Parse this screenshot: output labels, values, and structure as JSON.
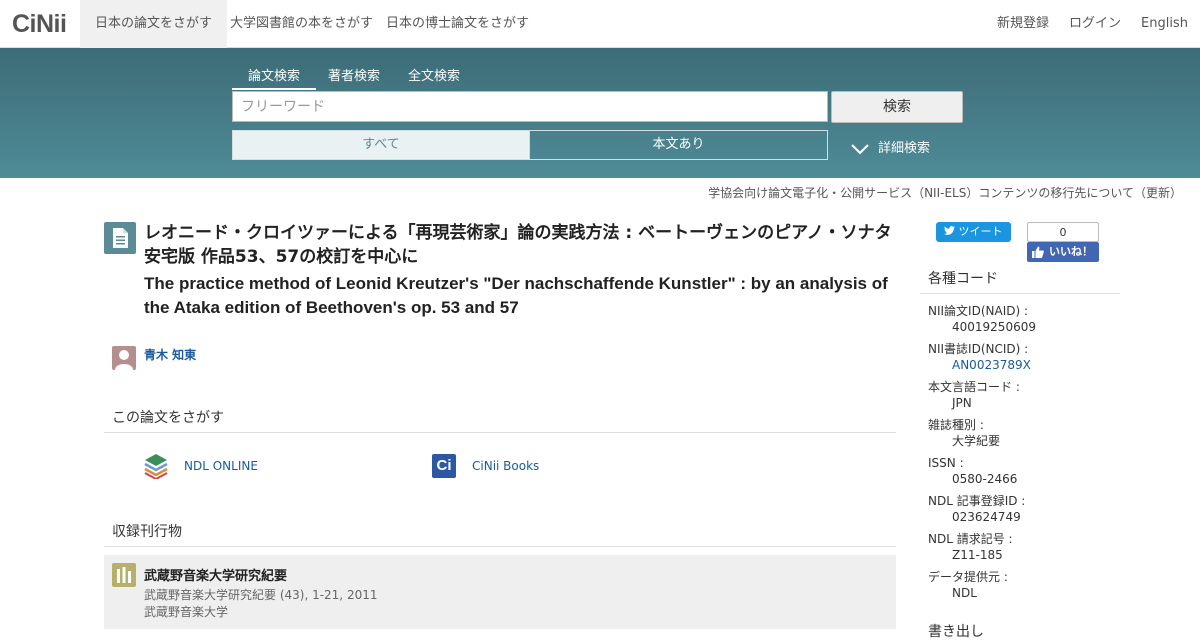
{
  "logo": "CiNii",
  "nav": {
    "tabs": [
      "日本の論文をさがす",
      "大学図書館の本をさがす",
      "日本の博士論文をさがす"
    ],
    "right": [
      "新規登録",
      "ログイン",
      "English"
    ]
  },
  "search": {
    "tabs": [
      "論文検索",
      "著者検索",
      "全文検索"
    ],
    "placeholder": "フリーワード",
    "button": "検索",
    "filter_all": "すべて",
    "filter_fulltext": "本文あり",
    "advanced": "詳細検索"
  },
  "notice": "学協会向け論文電子化・公開サービス（NII-ELS）コンテンツの移行先について（更新）",
  "article": {
    "title_ja": "レオニード・クロイツァーによる「再現芸術家」論の実践方法 : ベートーヴェンのピアノ・ソナタ安宅版 作品53、57の校訂を中心に",
    "title_en": "The practice method of Leonid Kreutzer's \"Der nachschaffende Kunstler\" : by an analysis of the Ataka edition of Beethoven's op. 53 and 57",
    "author": "青木 知東"
  },
  "find": {
    "heading": "この論文をさがす",
    "ndl": "NDL ONLINE",
    "cinii_books": "CiNii Books",
    "cinii_books_icon_text": "Ci"
  },
  "journal": {
    "heading": "収録刊行物",
    "title": "武蔵野音楽大学研究紀要",
    "sub": "武蔵野音楽大学研究紀要 (43), 1-21, 2011",
    "publisher": "武蔵野音楽大学"
  },
  "social": {
    "tweet": "ツイート",
    "like_count": "0",
    "like": "いいね！"
  },
  "sidebar": {
    "heading": "各種コード",
    "codes": [
      {
        "label": "NII論文ID(NAID) :",
        "value": "40019250609",
        "link": false
      },
      {
        "label": "NII書誌ID(NCID) :",
        "value": "AN0023789X",
        "link": true
      },
      {
        "label": "本文言語コード :",
        "value": "JPN",
        "link": false
      },
      {
        "label": "雑誌種別 :",
        "value": "大学紀要",
        "link": false
      },
      {
        "label": "ISSN :",
        "value": "0580-2466",
        "link": false
      },
      {
        "label": "NDL 記事登録ID :",
        "value": "023624749",
        "link": false
      },
      {
        "label": "NDL 請求記号 :",
        "value": "Z11-185",
        "link": false
      },
      {
        "label": "データ提供元 :",
        "value": "NDL",
        "link": false
      }
    ],
    "export_heading": "書き出し"
  },
  "colors": {
    "band": "#4f8b97",
    "link": "#1a5a9c"
  }
}
